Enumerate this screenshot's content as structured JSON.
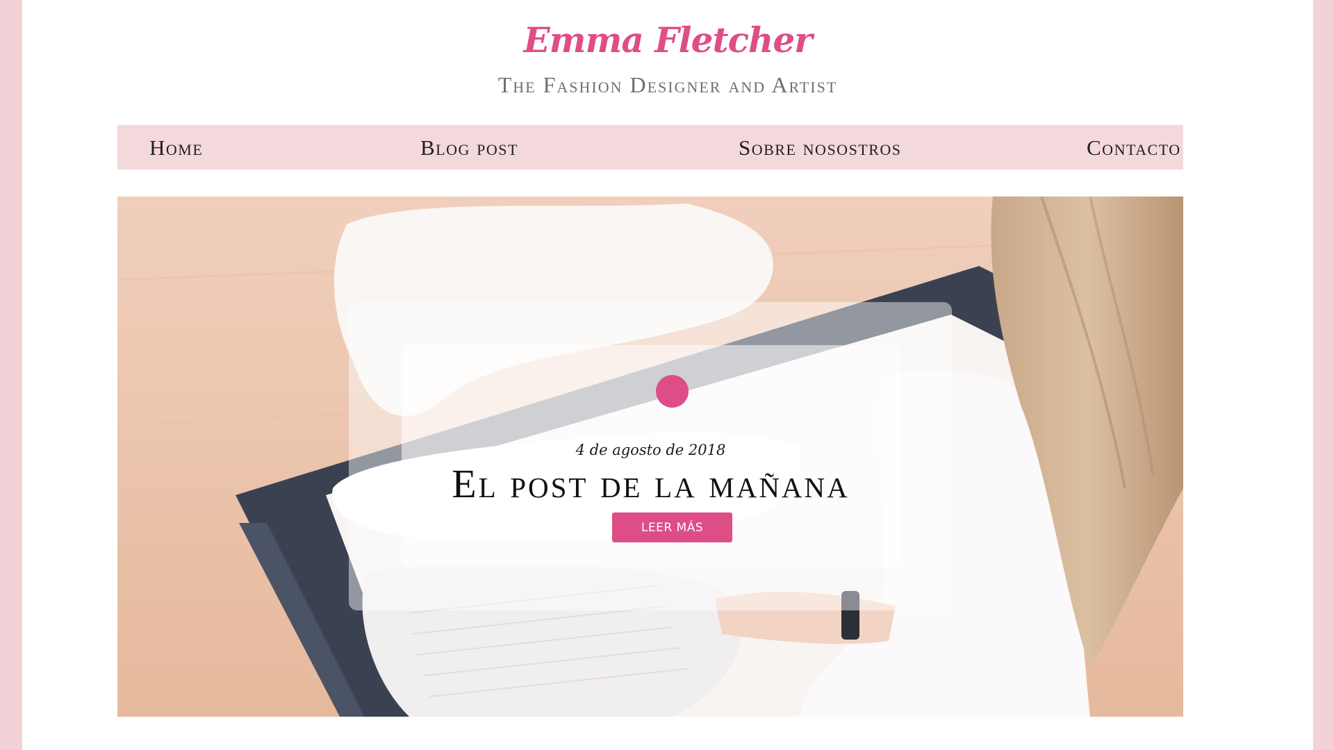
{
  "header": {
    "site_title": "Emma Fletcher",
    "tagline": "The Fashion Designer and Artist"
  },
  "nav": {
    "items": [
      {
        "label": "Home"
      },
      {
        "label": "Blog post"
      },
      {
        "label": "Sobre nosostros"
      },
      {
        "label": "Contacto"
      }
    ]
  },
  "hero": {
    "post_date": "4 de agosto de 2018",
    "post_title": "El post de la mañana",
    "read_more_label": "LEER MÁS"
  },
  "colors": {
    "accent": "#df4d87",
    "nav_background": "#f3d9dc",
    "page_frame": "#f2d2d6"
  }
}
